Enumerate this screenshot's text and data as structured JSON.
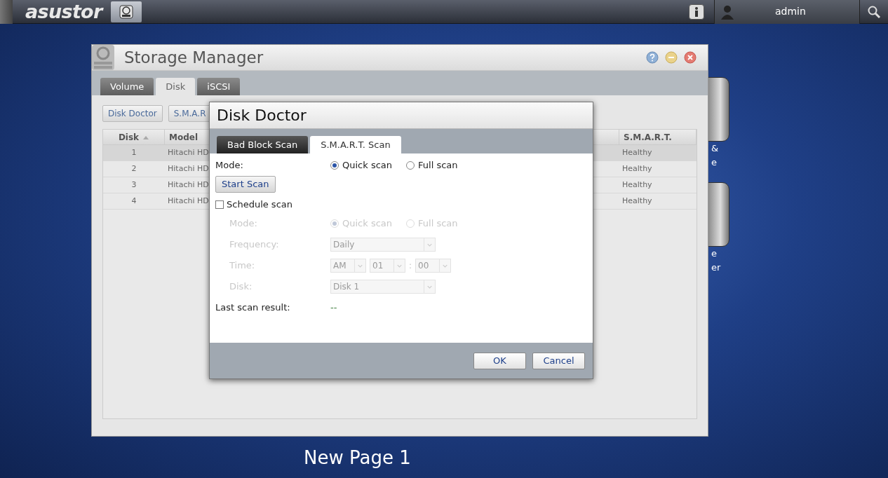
{
  "top_bar": {
    "logo": "asustor",
    "user": "admin"
  },
  "desktop_icons": [
    {
      "label_lines": [
        "&",
        "e"
      ]
    },
    {
      "label_lines": [
        "e",
        "er"
      ]
    }
  ],
  "window": {
    "title": "Storage Manager",
    "tabs": [
      {
        "label": "Volume",
        "selected": false
      },
      {
        "label": "Disk",
        "selected": true
      },
      {
        "label": "iSCSI",
        "selected": false
      }
    ],
    "toolbar": [
      "Disk Doctor",
      "S.M.A.R"
    ],
    "table": {
      "columns": [
        {
          "label": "Disk",
          "sorted": true
        },
        {
          "label": "Model",
          "sorted": false
        },
        {
          "label": "S.M.A.R.T.",
          "sorted": false
        }
      ],
      "rows": [
        {
          "disk": "1",
          "model": "Hitachi HD",
          "smart": "Healthy",
          "selected": true
        },
        {
          "disk": "2",
          "model": "Hitachi HD",
          "smart": "Healthy",
          "selected": false
        },
        {
          "disk": "3",
          "model": "Hitachi HD",
          "smart": "Healthy",
          "selected": false
        },
        {
          "disk": "4",
          "model": "Hitachi HD",
          "smart": "Healthy",
          "selected": false
        }
      ]
    }
  },
  "dialog": {
    "title": "Disk Doctor",
    "tabs": [
      {
        "label": "Bad Block Scan",
        "selected": false
      },
      {
        "label": "S.M.A.R.T. Scan",
        "selected": true
      }
    ],
    "mode_label": "Mode:",
    "mode_options": [
      {
        "label": "Quick scan",
        "selected": true
      },
      {
        "label": "Full scan",
        "selected": false
      }
    ],
    "start_button": "Start Scan",
    "schedule": {
      "label": "Schedule scan",
      "checked": false,
      "mode_label": "Mode:",
      "mode_options": [
        {
          "label": "Quick scan",
          "selected": true
        },
        {
          "label": "Full scan",
          "selected": false
        }
      ],
      "frequency_label": "Frequency:",
      "frequency": "Daily",
      "time_label": "Time:",
      "ampm": "AM",
      "hour": "01",
      "separator": ":",
      "minute": "00",
      "disk_label": "Disk:",
      "disk": "Disk 1"
    },
    "last_result_label": "Last scan result:",
    "last_result": "--",
    "buttons": [
      "OK",
      "Cancel"
    ]
  },
  "page_label": "New Page 1"
}
